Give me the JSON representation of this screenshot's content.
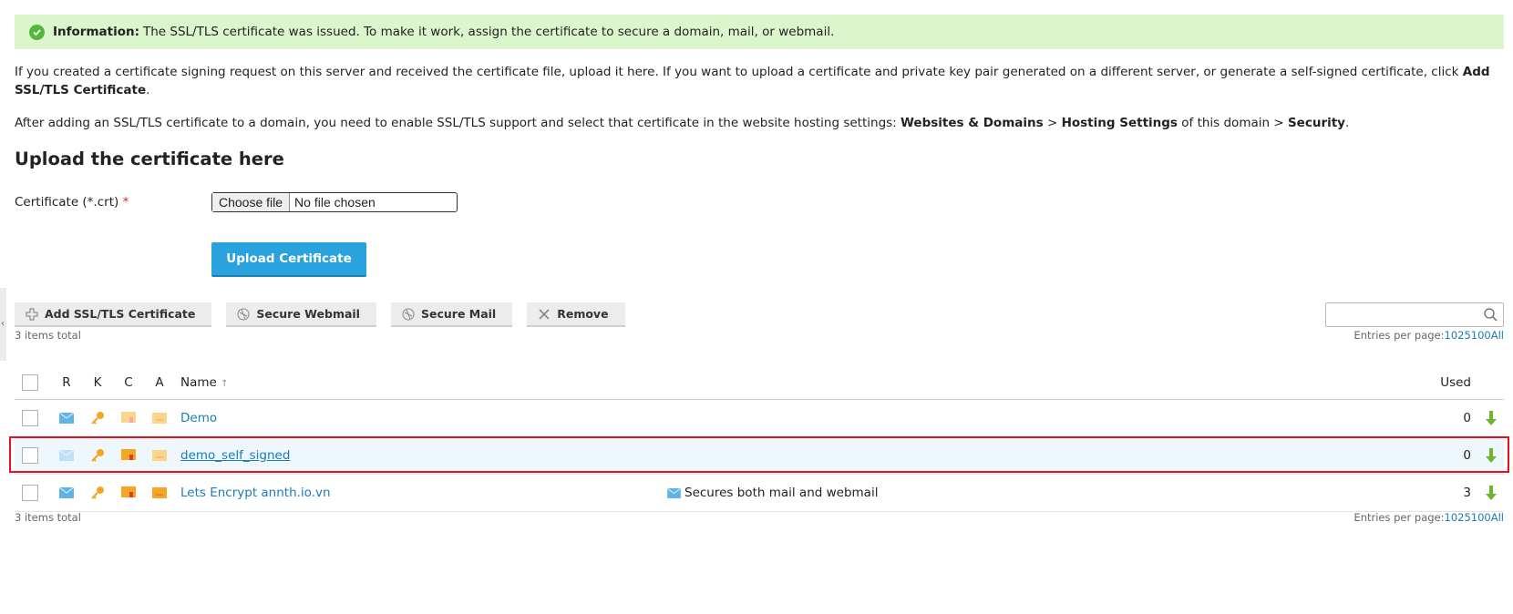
{
  "info": {
    "label": "Information:",
    "text": "The SSL/TLS certificate was issued. To make it work, assign the certificate to secure a domain, mail, or webmail."
  },
  "desc1": {
    "text": "If you created a certificate signing request on this server and received the certificate file, upload it here. If you want to upload a certificate and private key pair generated on a different server, or generate a self-signed certificate, click ",
    "bold": "Add SSL/TLS Certificate",
    "end": "."
  },
  "desc2": {
    "text1": "After adding an SSL/TLS certificate to a domain, you need to enable SSL/TLS support and select that certificate in the website hosting settings: ",
    "bold1": "Websites & Domains",
    "sep1": " > ",
    "bold2": "Hosting Settings",
    "text2": " of this domain > ",
    "bold3": "Security",
    "end": "."
  },
  "upload": {
    "title": "Upload the certificate here",
    "field_label": "Certificate (*.crt)",
    "required_mark": "*",
    "choose_file": "Choose file",
    "file_status": "No file chosen",
    "button": "Upload Certificate"
  },
  "toolbar": {
    "add": "Add SSL/TLS Certificate",
    "secure_webmail": "Secure Webmail",
    "secure_mail": "Secure Mail",
    "remove": "Remove"
  },
  "search": {
    "placeholder": ""
  },
  "summary": {
    "total": "3 items total",
    "entries_label": "Entries per page:",
    "pages": [
      "10",
      "25",
      "100",
      "All"
    ]
  },
  "table": {
    "headers": {
      "r": "R",
      "k": "K",
      "c": "C",
      "a": "A",
      "name": "Name",
      "sort": "↑",
      "used": "Used"
    },
    "rows": [
      {
        "name": "Demo",
        "extra": "",
        "used": "0"
      },
      {
        "name": "demo_self_signed",
        "extra": "",
        "used": "0"
      },
      {
        "name": "Lets Encrypt annth.io.vn",
        "extra": "Secures both mail and webmail",
        "used": "3"
      }
    ]
  },
  "colors": {
    "accent": "#1a7cb8",
    "upload_button": "#2aa2dd",
    "info_bg": "#dbf5cc",
    "highlight": "#e4121d"
  }
}
